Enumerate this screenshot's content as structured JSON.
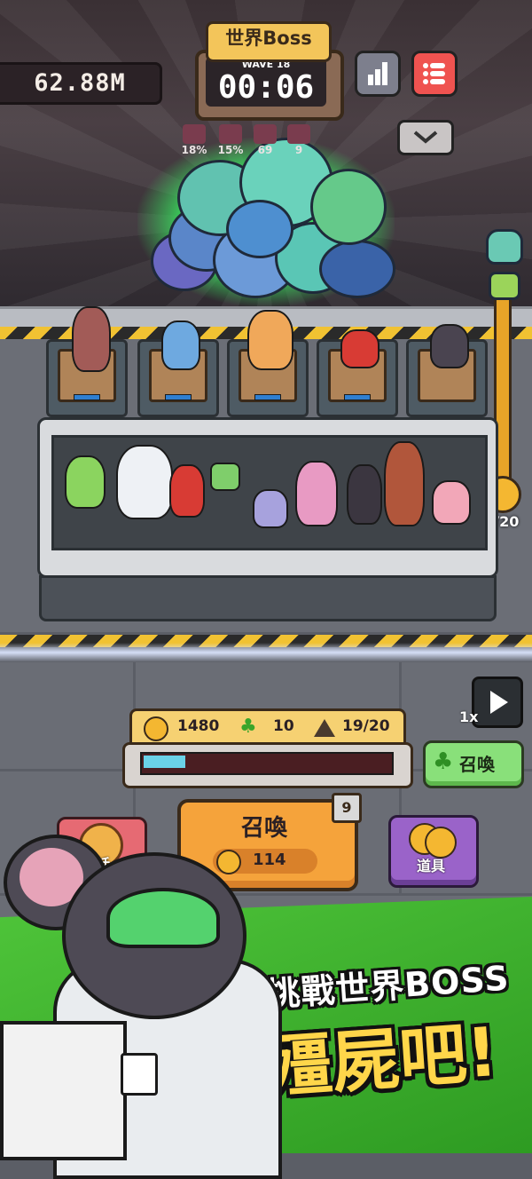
{
  "hud": {
    "score": "62.88M",
    "boss_title": "世界Boss",
    "wave_label": "WAVE 18",
    "timer": "00:06",
    "stats_icon": "bar-chart-icon",
    "menu_icon": "list-icon",
    "expand_icon": "chevron-down-icon"
  },
  "debuffs": [
    {
      "icon": "worm-debuff-icon",
      "value": "18%"
    },
    {
      "icon": "crossbow-debuff-icon",
      "value": "15%"
    },
    {
      "icon": "armor-debuff-icon",
      "value": "69"
    },
    {
      "icon": "paw-debuff-icon",
      "value": "9"
    }
  ],
  "boss_gauge": {
    "value": "18/20",
    "fill": 0.9
  },
  "resources": {
    "coins": "1480",
    "clover": "10",
    "units": "19/20",
    "progress": 0.17
  },
  "controls": {
    "speed": "1x",
    "summon_label": "召喚",
    "summon_cost": "114",
    "summon_badge": "9",
    "lucky_label": "召喚",
    "item_label": "道具",
    "god_label": "神話"
  },
  "promo": {
    "line1": "挑戰世界BOSS",
    "line2": "殭屍吧!"
  },
  "colors": {
    "accent": "#f5a33b",
    "boss_glow": "#3ad35b",
    "lucky": "#89e07a",
    "item": "#9a63c9",
    "god": "#e66a73",
    "promo_green": "#3bb02d"
  }
}
